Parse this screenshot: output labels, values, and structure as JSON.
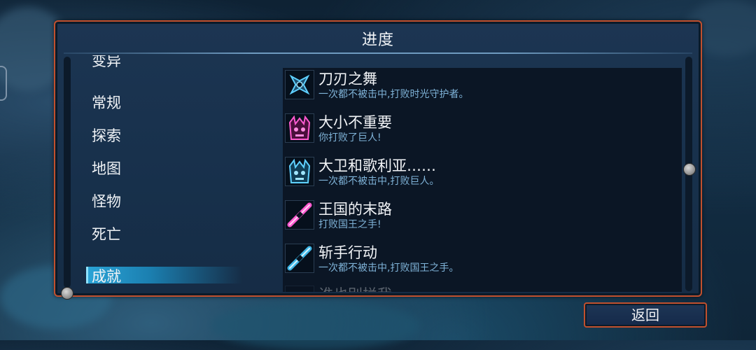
{
  "panel": {
    "title": "进度"
  },
  "categories": [
    {
      "label": "变异",
      "selected": false
    },
    {
      "label": "常规",
      "selected": false
    },
    {
      "label": "探索",
      "selected": false
    },
    {
      "label": "地图",
      "selected": false
    },
    {
      "label": "怪物",
      "selected": false
    },
    {
      "label": "死亡",
      "selected": false
    },
    {
      "label": "成就",
      "selected": true
    }
  ],
  "achievements": [
    {
      "title": "刀刃之舞",
      "desc": "一次都不被击中,打败时光守护者。",
      "icon": "shuriken-icon",
      "color": "#3fb6e6"
    },
    {
      "title": "大小不重要",
      "desc": "你打败了巨人!",
      "icon": "giant-skull-icon",
      "color": "#e23ab0"
    },
    {
      "title": "大卫和歌利亚……",
      "desc": "一次都不被击中,打败巨人。",
      "icon": "giant-skull-icon",
      "color": "#3fb6e6"
    },
    {
      "title": "王国的末路",
      "desc": "打败国王之手!",
      "icon": "blade-icon",
      "color": "#e23ab0"
    },
    {
      "title": "斩手行动",
      "desc": "一次都不被击中,打败国王之手。",
      "icon": "blade-icon",
      "color": "#3fb6e6"
    },
    {
      "title": "谁也别拦我",
      "desc": "",
      "icon": "check-icon",
      "color": "#e23ab0"
    }
  ],
  "footer": {
    "return_label": "返回"
  }
}
